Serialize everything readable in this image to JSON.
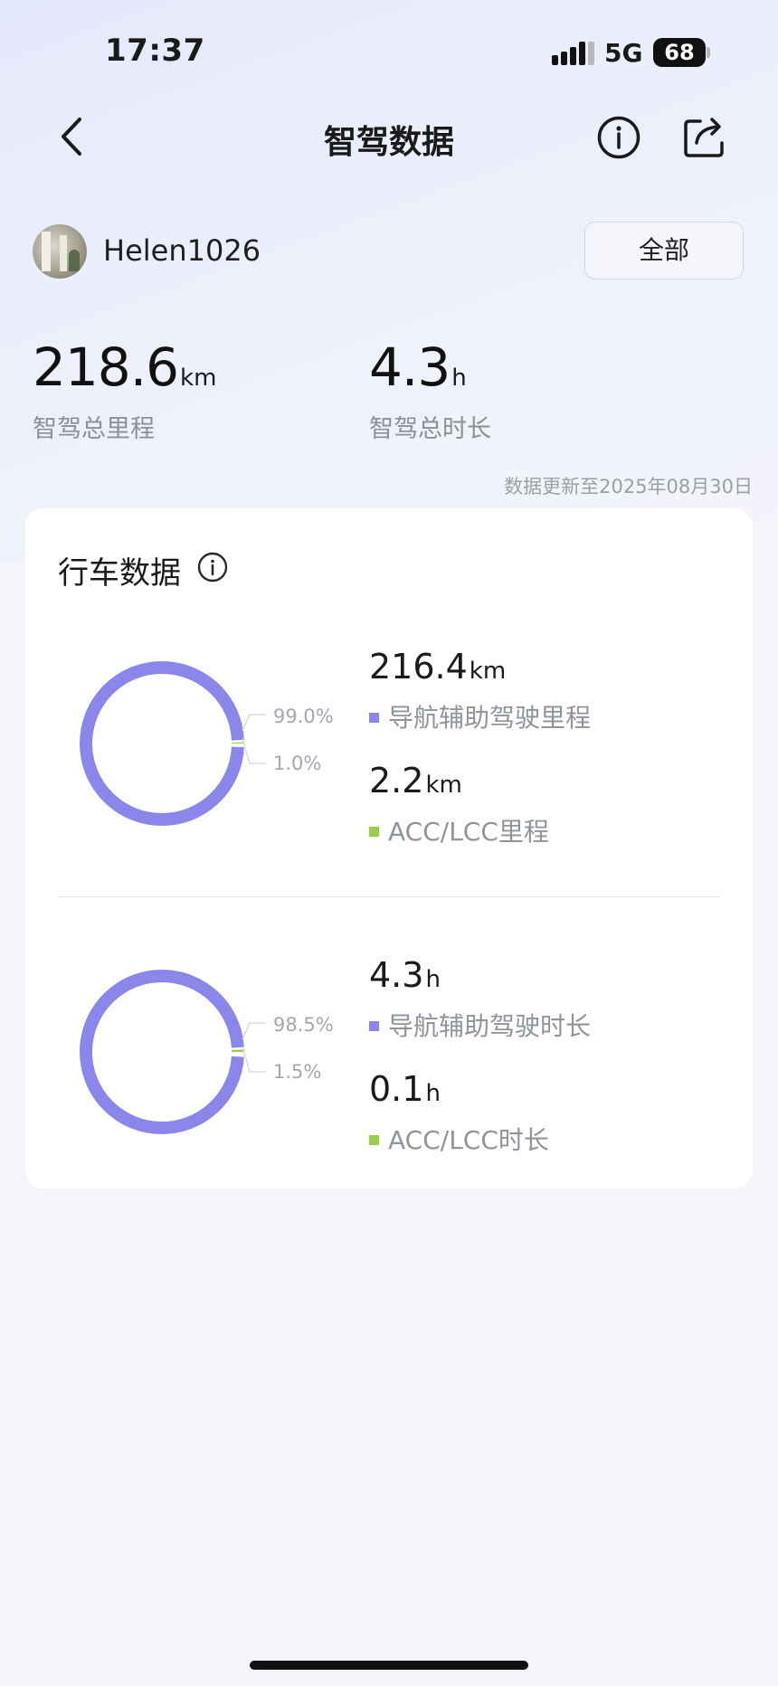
{
  "status_bar": {
    "time": "17:37",
    "network": "5G",
    "battery": "68"
  },
  "nav": {
    "title": "智驾数据"
  },
  "user": {
    "name": "Helen1026",
    "filter_label": "全部"
  },
  "summary": {
    "total_distance": {
      "value": "218.6",
      "unit": "km",
      "label": "智驾总里程"
    },
    "total_duration": {
      "value": "4.3",
      "unit": "h",
      "label": "智驾总时长"
    },
    "updated": "数据更新至2025年08月30日"
  },
  "card": {
    "title": "行车数据",
    "colors": {
      "primary": "#8b87ea",
      "secondary": "#9ccc4e"
    },
    "distance": {
      "primary": {
        "value": "216.4",
        "unit": "km",
        "label": "导航辅助驾驶里程",
        "pct": "99.0%",
        "fraction": 0.99
      },
      "secondary": {
        "value": "2.2",
        "unit": "km",
        "label": "ACC/LCC里程",
        "pct": "1.0%",
        "fraction": 0.01
      }
    },
    "duration": {
      "primary": {
        "value": "4.3",
        "unit": "h",
        "label": "导航辅助驾驶时长",
        "pct": "98.5%",
        "fraction": 0.985
      },
      "secondary": {
        "value": "0.1",
        "unit": "h",
        "label": "ACC/LCC时长",
        "pct": "1.5%",
        "fraction": 0.015
      }
    }
  }
}
